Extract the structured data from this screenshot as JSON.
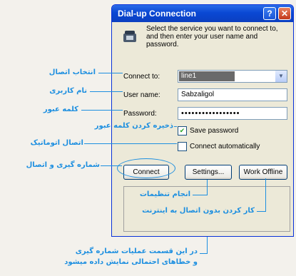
{
  "dialog": {
    "title": "Dial-up Connection",
    "help_glyph": "?",
    "close_glyph": "✕",
    "intro": "Select the service you want to connect to, and then enter your user name and password.",
    "connect_to": {
      "label": "Connect to:",
      "value": "line1"
    },
    "user_name": {
      "label": "User name:",
      "value": "Sabzaligol"
    },
    "password": {
      "label": "Password:",
      "value": "•••••••••••••••••"
    },
    "save_password": {
      "label": "Save password",
      "checked": true
    },
    "connect_automatically": {
      "label": "Connect automatically",
      "checked": false
    },
    "buttons": {
      "connect": "Connect",
      "settings": "Settings...",
      "work_offline": "Work Offline"
    }
  },
  "annotations": {
    "connect_to": "انتخاب اتصال",
    "user_name": "نام کاربری",
    "password": "کلمه عبور",
    "save_password": "ذخیره کردن کلمه عبور",
    "connect_automatically": "اتصال اتوماتیک",
    "connect": "شماره گیری و اتصال",
    "settings": "انجام تنظیمات",
    "work_offline": "کار کردن بدون اتصال به اینترنت",
    "status_line1": "در این قسمت عملیات شماره گیری",
    "status_line2": "و خطاهای احتمالی نمایش داده میشود"
  },
  "colors": {
    "annotation": "#1d8fe0",
    "titlebar": "#0a48d4"
  }
}
